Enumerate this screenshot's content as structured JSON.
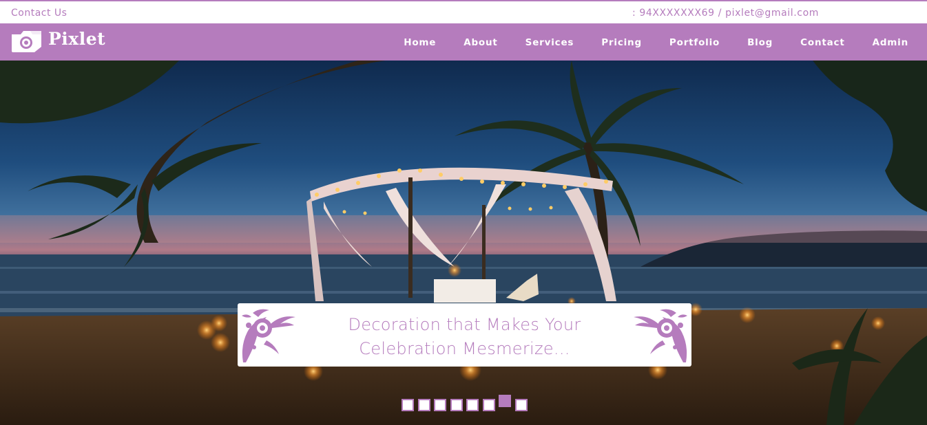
{
  "topbar": {
    "contact_label": "Contact Us",
    "contact_info": ": 94XXXXXXX69 / pixlet@gmail.com"
  },
  "brand": {
    "name": "Pixlet",
    "icon": "camera-logo-icon",
    "color": "#b57cbd"
  },
  "nav": {
    "items": [
      {
        "label": "Home"
      },
      {
        "label": "About"
      },
      {
        "label": "Services"
      },
      {
        "label": "Pricing"
      },
      {
        "label": "Portfolio"
      },
      {
        "label": "Blog"
      },
      {
        "label": "Contact"
      },
      {
        "label": "Admin"
      }
    ]
  },
  "hero": {
    "caption_line1": "Decoration that Makes Your",
    "caption_line2": "Celebration Mesmerize...",
    "ornament_icon": "floral-ornament-icon",
    "slide_count": 8,
    "active_slide": 7
  }
}
